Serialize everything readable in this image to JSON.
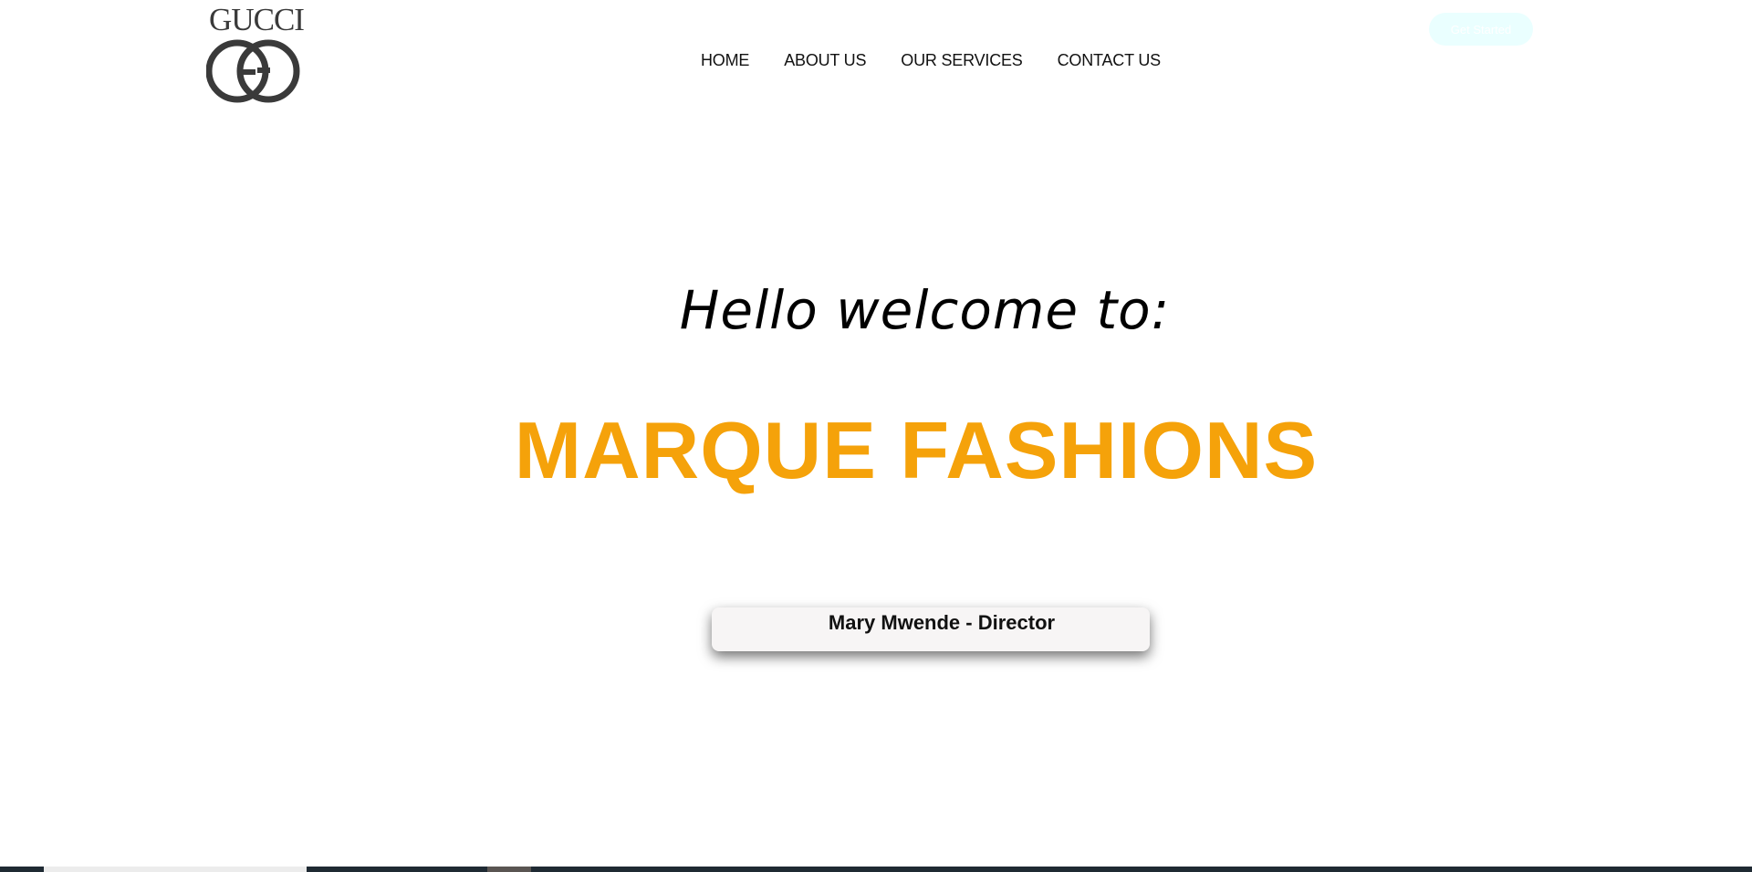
{
  "logo": {
    "text": "GUCCI",
    "icon": "gucci-double-g-logo-icon"
  },
  "nav": {
    "items": [
      {
        "label": "HOME"
      },
      {
        "label": "ABOUT US"
      },
      {
        "label": "OUR SERVICES"
      },
      {
        "label": "CONTACT US"
      }
    ]
  },
  "cta": {
    "label": "Get Started"
  },
  "hero": {
    "greeting": "Hello welcome to:",
    "brand": "MARQUE FASHIONS",
    "director": "Mary Mwende - Director"
  },
  "colors": {
    "brand_orange": "#f5a20a",
    "cta_background": "#eaffff",
    "logo_gray": "#3a3a3a"
  }
}
